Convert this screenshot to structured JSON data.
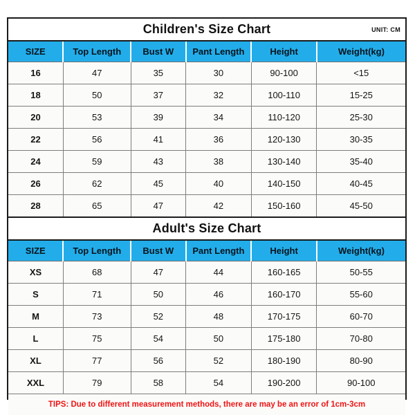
{
  "unit_label": "UNIT: CM",
  "columns": [
    "SIZE",
    "Top Length",
    "Bust W",
    "Pant Length",
    "Height",
    "Weight(kg)"
  ],
  "colors": {
    "header_blue": "#22ADEA",
    "cell_background": "#FBFBF9",
    "border_dark": "#1A1A1A",
    "grid_gray": "#7D7D7D",
    "tips_red": "#EE1414"
  },
  "children": {
    "title": "Children's Size Chart",
    "columns": [
      "SIZE",
      "Top Length",
      "Bust W",
      "Pant Length",
      "Height",
      "Weight(kg)"
    ],
    "rows": [
      [
        "16",
        "47",
        "35",
        "30",
        "90-100",
        "<15"
      ],
      [
        "18",
        "50",
        "37",
        "32",
        "100-110",
        "15-25"
      ],
      [
        "20",
        "53",
        "39",
        "34",
        "110-120",
        "25-30"
      ],
      [
        "22",
        "56",
        "41",
        "36",
        "120-130",
        "30-35"
      ],
      [
        "24",
        "59",
        "43",
        "38",
        "130-140",
        "35-40"
      ],
      [
        "26",
        "62",
        "45",
        "40",
        "140-150",
        "40-45"
      ],
      [
        "28",
        "65",
        "47",
        "42",
        "150-160",
        "45-50"
      ]
    ]
  },
  "adult": {
    "title": "Adult's Size Chart",
    "columns": [
      "SIZE",
      "Top Length",
      "Bust W",
      "Pant Length",
      "Height",
      "Weight(kg)"
    ],
    "rows": [
      [
        "XS",
        "68",
        "47",
        "44",
        "160-165",
        "50-55"
      ],
      [
        "S",
        "71",
        "50",
        "46",
        "160-170",
        "55-60"
      ],
      [
        "M",
        "73",
        "52",
        "48",
        "170-175",
        "60-70"
      ],
      [
        "L",
        "75",
        "54",
        "50",
        "175-180",
        "70-80"
      ],
      [
        "XL",
        "77",
        "56",
        "52",
        "180-190",
        "80-90"
      ],
      [
        "XXL",
        "79",
        "58",
        "54",
        "190-200",
        "90-100"
      ]
    ]
  },
  "tips": "TIPS: Due to different measurement methods, there are may be an error of 1cm-3cm"
}
